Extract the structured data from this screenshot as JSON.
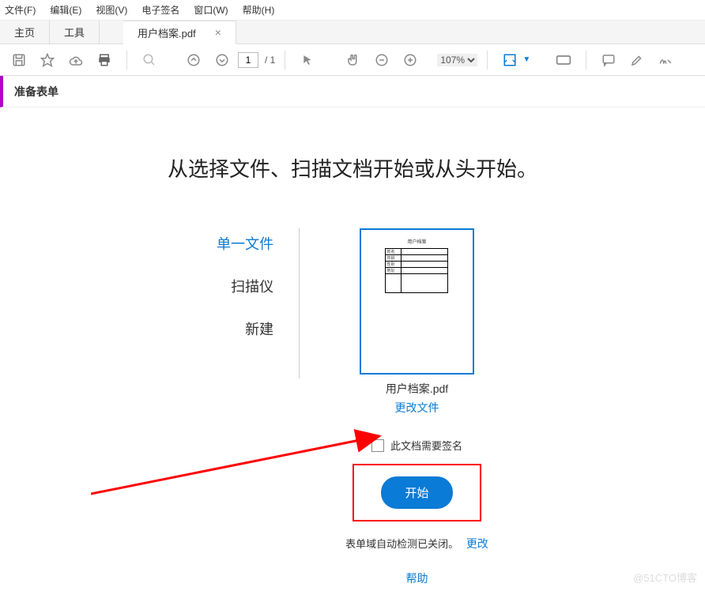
{
  "menu": {
    "file": "文件(F)",
    "edit": "编辑(E)",
    "view": "视图(V)",
    "esign": "电子签名",
    "window": "窗口(W)",
    "help": "帮助(H)"
  },
  "tabs": {
    "home": "主页",
    "tools": "工具",
    "doc": "用户档案.pdf"
  },
  "toolbar": {
    "page_current": "1",
    "page_total": "/ 1",
    "zoom": "107%"
  },
  "subheader": "准备表单",
  "heading": "从选择文件、扫描文档开始或从头开始。",
  "options": {
    "single": "单一文件",
    "scanner": "扫描仪",
    "new": "新建"
  },
  "preview": {
    "file_name": "用户档案.pdf",
    "change": "更改文件",
    "inner_title": "用户档案",
    "rows": [
      "姓名",
      "年龄",
      "性别",
      "地址",
      ""
    ]
  },
  "sign_label": "此文档需要签名",
  "start": "开始",
  "detect_text": "表单域自动检测已关闭。",
  "detect_change": "更改",
  "help_link": "帮助",
  "watermark": "@51CTO博客"
}
